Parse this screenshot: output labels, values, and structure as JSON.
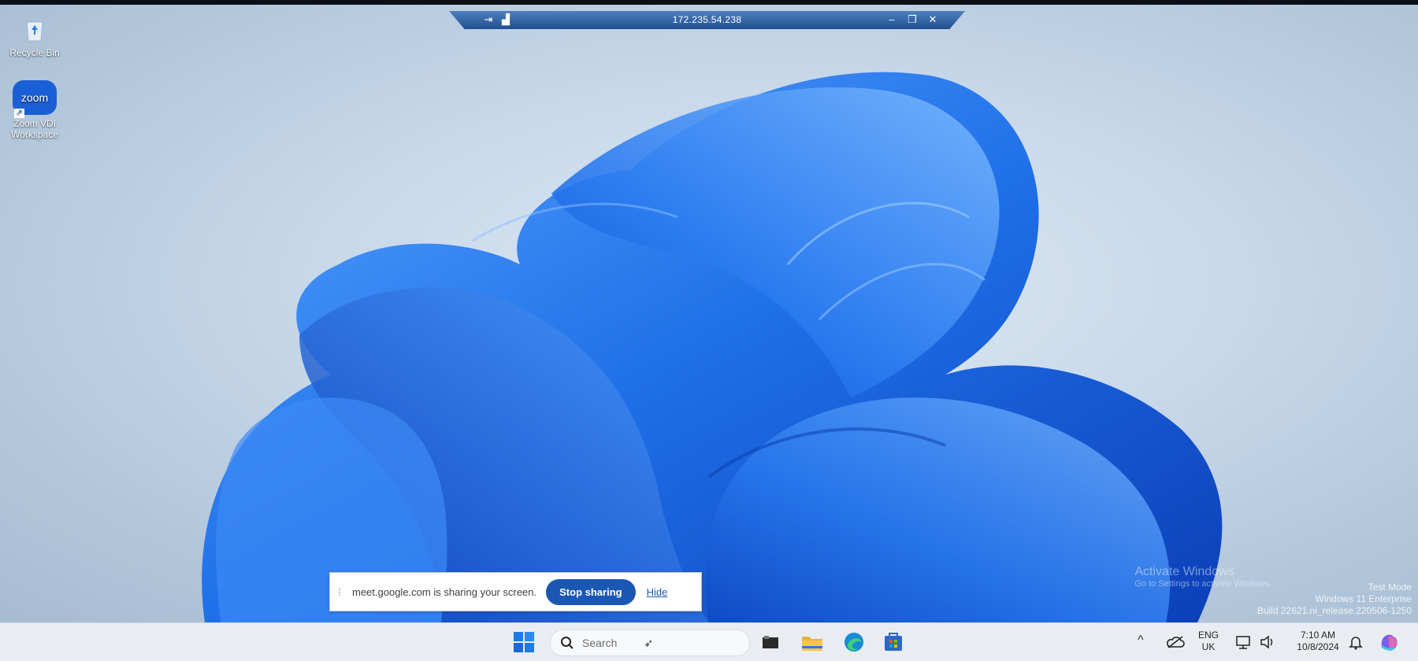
{
  "rdp": {
    "address": "172.235.54.238"
  },
  "desktop_icons": [
    {
      "label": "Recycle Bin",
      "icon": "recycle-bin-icon"
    },
    {
      "label": "Zoom VDI Workspace",
      "icon": "zoom-icon",
      "badge": "zoom"
    }
  ],
  "watermark": {
    "activate_title": "Activate Windows",
    "activate_sub": "Go to Settings to activate Windows.",
    "line1": "Test Mode",
    "line2": "Windows 11 Enterprise",
    "line3": "Build 22621.ni_release.220506-1250"
  },
  "share_bar": {
    "message": "meet.google.com is sharing your screen.",
    "stop_label": "Stop sharing",
    "hide_label": "Hide"
  },
  "taskbar": {
    "search_placeholder": "Search",
    "apps": [
      "start-icon",
      "task-view-icon",
      "file-explorer-icon",
      "edge-icon",
      "store-icon"
    ],
    "tray": {
      "lang": "ENG",
      "region": "UK",
      "time": "7:10 AM",
      "date": "10/8/2024"
    }
  },
  "colors": {
    "accent": "#1a57b3",
    "bloom": "#1e6be6",
    "rdp_bar": "#2f62a6"
  }
}
